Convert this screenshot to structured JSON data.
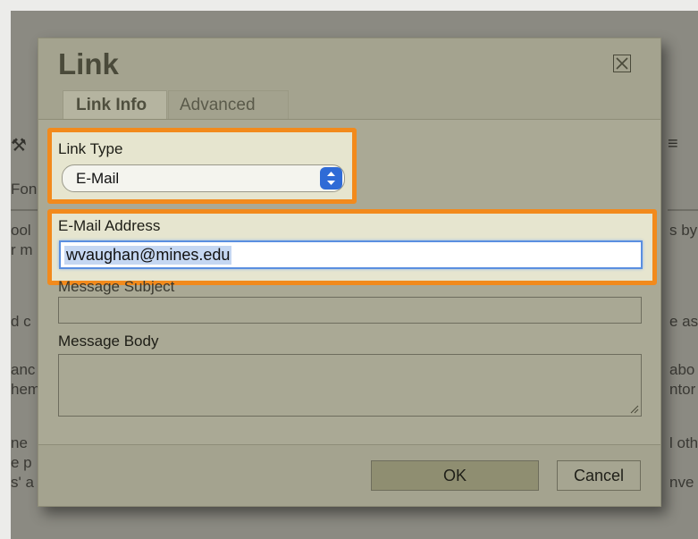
{
  "background": {
    "left_fragments": [
      "Fon",
      "ool",
      "r m",
      "d c",
      "anc",
      "hem",
      "ne",
      "e p",
      "s' a"
    ],
    "right_fragments": [
      "s by",
      "e as",
      "abo",
      "ntor",
      "l oth",
      "nve"
    ]
  },
  "dialog": {
    "title": "Link",
    "close_icon": "close-box-icon",
    "tabs": [
      {
        "label": "Link Info",
        "active": true
      },
      {
        "label": "Advanced",
        "active": false
      }
    ],
    "link_type": {
      "label": "Link Type",
      "selected": "E-Mail"
    },
    "email": {
      "label": "E-Mail Address",
      "value": "wvaughan@mines.edu"
    },
    "subject": {
      "label": "Message Subject",
      "value": ""
    },
    "body": {
      "label": "Message Body",
      "value": ""
    },
    "buttons": {
      "ok": "OK",
      "cancel": "Cancel"
    }
  },
  "colors": {
    "highlight": "#f28a1c",
    "dialog_bg": "#a4a38f",
    "select_accent": "#2f6bd6"
  }
}
